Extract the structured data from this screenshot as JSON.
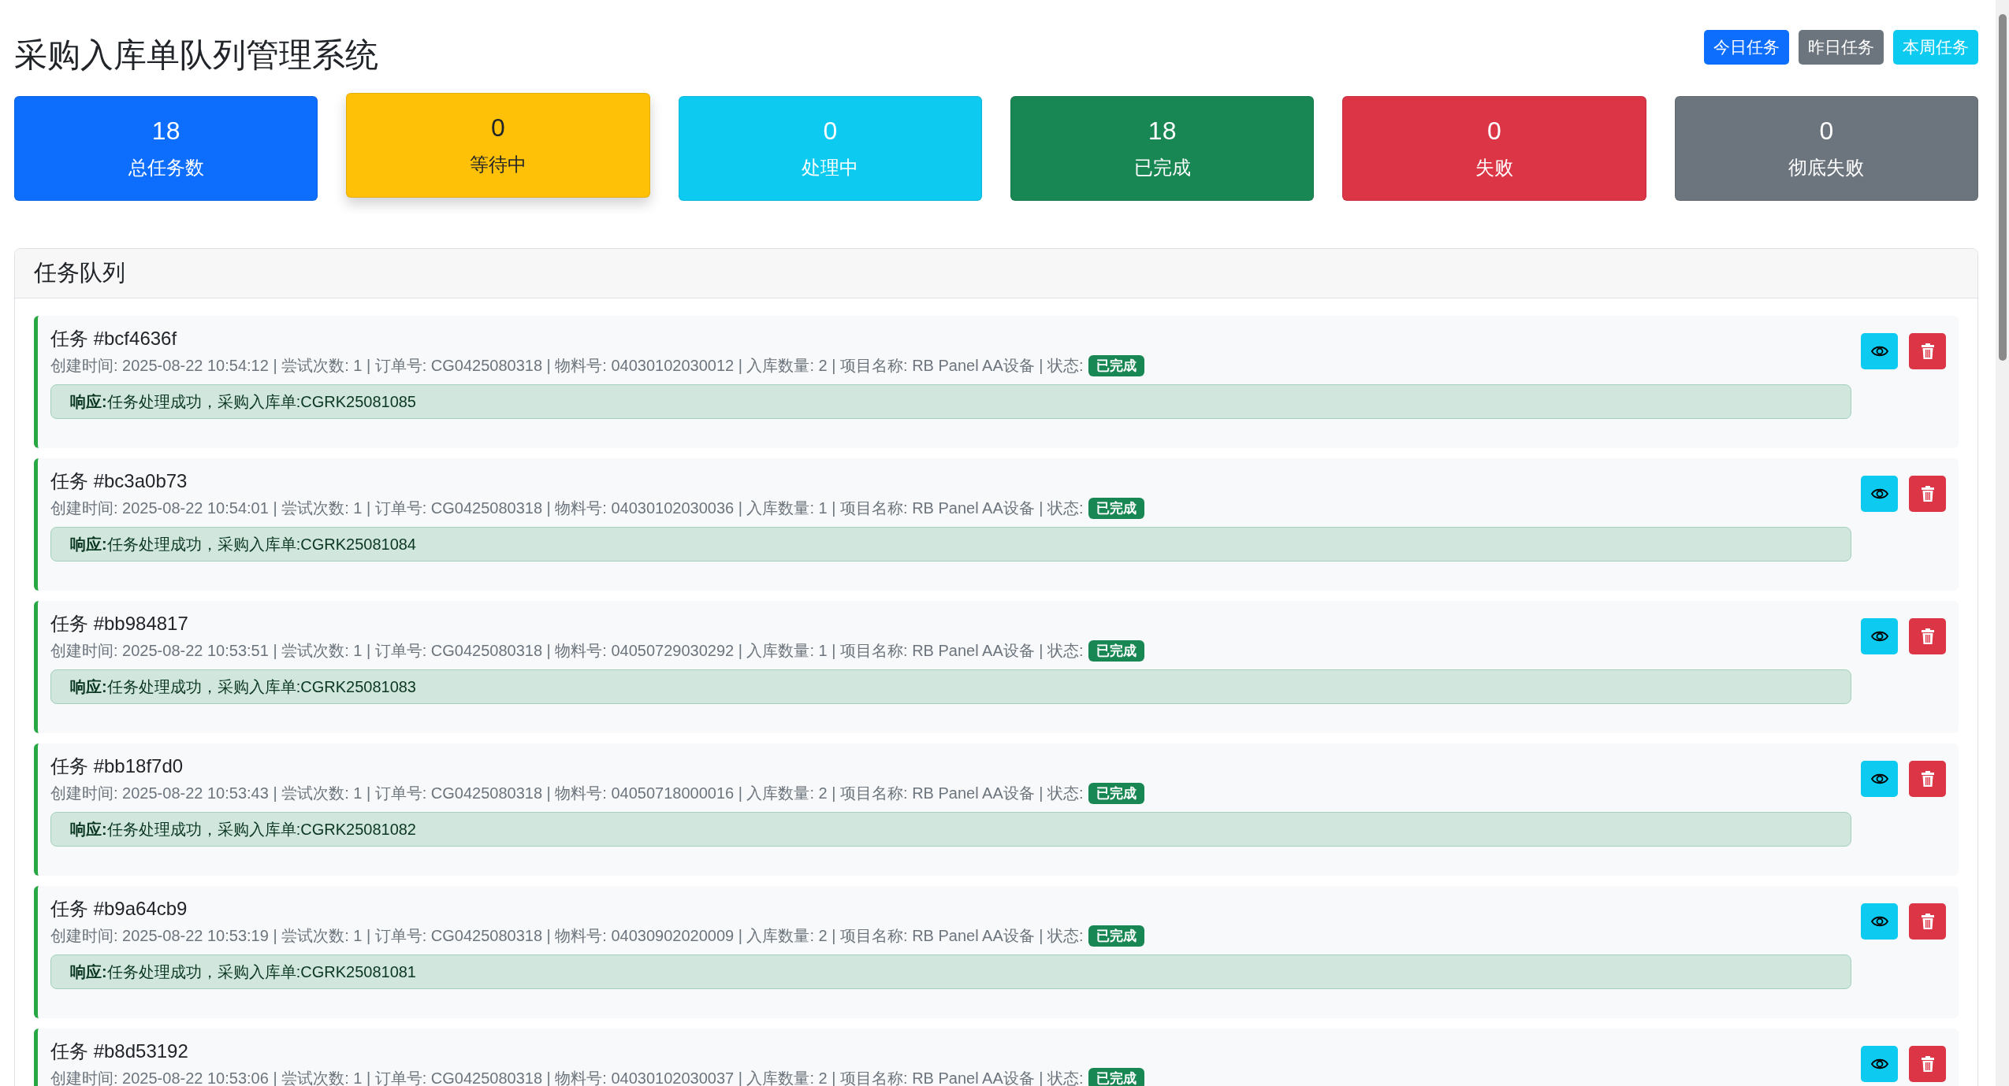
{
  "title": "采购入库单队列管理系统",
  "filters": [
    {
      "label": "今日任务",
      "color": "#0d6efd"
    },
    {
      "label": "昨日任务",
      "color": "#6c757d"
    },
    {
      "label": "本周任务",
      "color": "#0dcaf0"
    }
  ],
  "stats": [
    {
      "value": "18",
      "label": "总任务数",
      "color": "#0d6efd",
      "hovered": false
    },
    {
      "value": "0",
      "label": "等待中",
      "color": "#ffc107",
      "hovered": true
    },
    {
      "value": "0",
      "label": "处理中",
      "color": "#0dcaf0",
      "hovered": false
    },
    {
      "value": "18",
      "label": "已完成",
      "color": "#198754",
      "hovered": false
    },
    {
      "value": "0",
      "label": "失败",
      "color": "#dc3545",
      "hovered": false
    },
    {
      "value": "0",
      "label": "彻底失败",
      "color": "#6c757d",
      "hovered": false
    }
  ],
  "queue": {
    "title": "任务队列",
    "tasks": [
      {
        "title": "任务 #bcf4636f",
        "meta": "创建时间: 2025-08-22 10:54:12 | 尝试次数: 1 | 订单号: CG0425080318 | 物料号: 04030102030012 | 入库数量: 2 | 项目名称: RB Panel AA设备 | 状态:",
        "status": "已完成",
        "response": "**响应:**任务处理成功，采购入库单:CGRK25081085"
      },
      {
        "title": "任务 #bc3a0b73",
        "meta": "创建时间: 2025-08-22 10:54:01 | 尝试次数: 1 | 订单号: CG0425080318 | 物料号: 04030102030036 | 入库数量: 1 | 项目名称: RB Panel AA设备 | 状态:",
        "status": "已完成",
        "response": "**响应:**任务处理成功，采购入库单:CGRK25081084"
      },
      {
        "title": "任务 #bb984817",
        "meta": "创建时间: 2025-08-22 10:53:51 | 尝试次数: 1 | 订单号: CG0425080318 | 物料号: 04050729030292 | 入库数量: 1 | 项目名称: RB Panel AA设备 | 状态:",
        "status": "已完成",
        "response": "**响应:**任务处理成功，采购入库单:CGRK25081083"
      },
      {
        "title": "任务 #bb18f7d0",
        "meta": "创建时间: 2025-08-22 10:53:43 | 尝试次数: 1 | 订单号: CG0425080318 | 物料号: 04050718000016 | 入库数量: 2 | 项目名称: RB Panel AA设备 | 状态:",
        "status": "已完成",
        "response": "**响应:**任务处理成功，采购入库单:CGRK25081082"
      },
      {
        "title": "任务 #b9a64cb9",
        "meta": "创建时间: 2025-08-22 10:53:19 | 尝试次数: 1 | 订单号: CG0425080318 | 物料号: 04030902020009 | 入库数量: 2 | 项目名称: RB Panel AA设备 | 状态:",
        "status": "已完成",
        "response": "**响应:**任务处理成功，采购入库单:CGRK25081081"
      },
      {
        "title": "任务 #b8d53192",
        "meta": "创建时间: 2025-08-22 10:53:06 | 尝试次数: 1 | 订单号: CG0425080318 | 物料号: 04030102030037 | 入库数量: 2 | 项目名称: RB Panel AA设备 | 状态:",
        "status": "已完成"
      }
    ]
  }
}
